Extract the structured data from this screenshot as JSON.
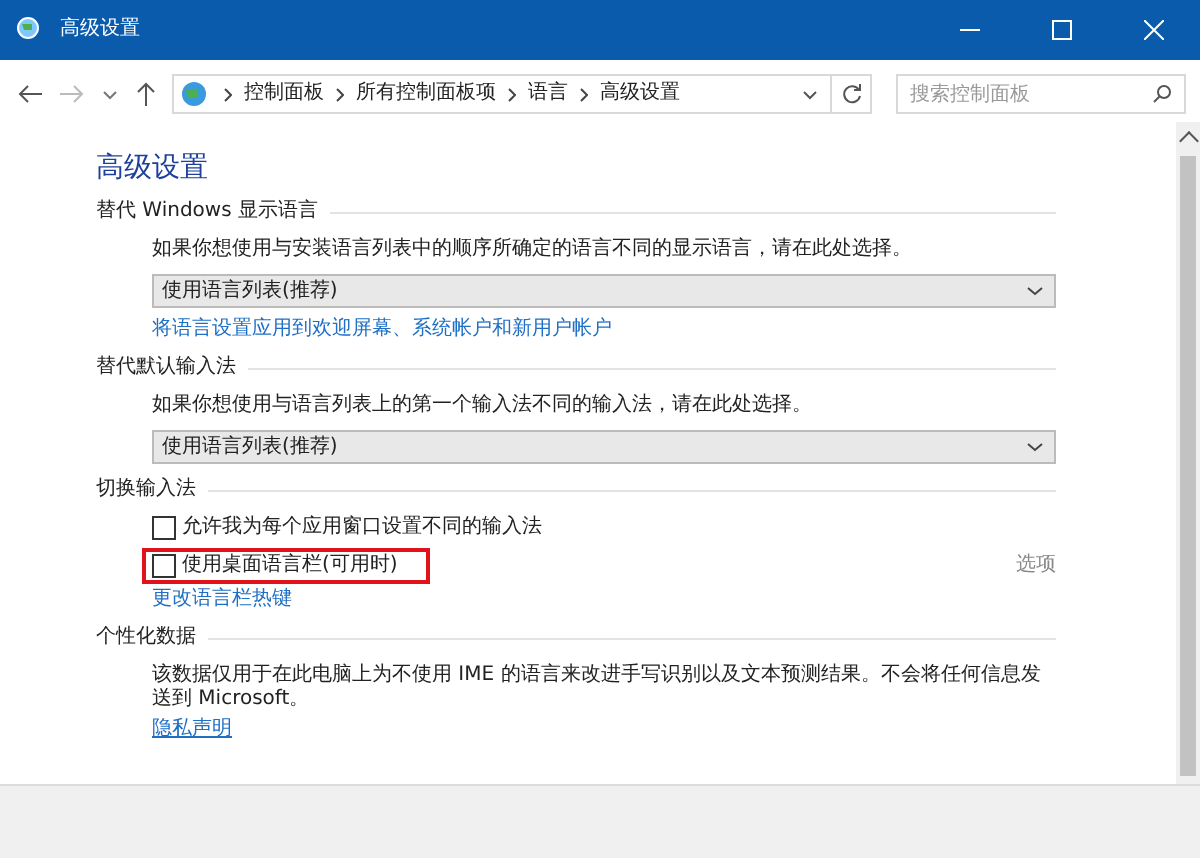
{
  "window": {
    "title": "高级设置"
  },
  "address_bar": {
    "crumbs": [
      "控制面板",
      "所有控制面板项",
      "语言",
      "高级设置"
    ]
  },
  "search": {
    "placeholder": "搜索控制面板"
  },
  "heading": "高级设置",
  "sections": [
    {
      "title": "替代 Windows 显示语言",
      "items": [
        {
          "kind": "text",
          "text": "如果你想使用与安装语言列表中的顺序所确定的语言不同的显示语言，请在此处选择。"
        },
        {
          "kind": "select",
          "value": "使用语言列表(推荐)"
        },
        {
          "kind": "link",
          "text": "将语言设置应用到欢迎屏幕、系统帐户和新用户帐户"
        }
      ]
    },
    {
      "title": "替代默认输入法",
      "items": [
        {
          "kind": "text",
          "text": "如果你想使用与语言列表上的第一个输入法不同的输入法，请在此处选择。"
        },
        {
          "kind": "select",
          "value": "使用语言列表(推荐)"
        }
      ]
    },
    {
      "title": "切换输入法",
      "items": [
        {
          "kind": "checkbox",
          "label": "允许我为每个应用窗口设置不同的输入法",
          "checked": false,
          "highlighted": false
        },
        {
          "kind": "checkbox",
          "label": "使用桌面语言栏(可用时)",
          "checked": false,
          "highlighted": true,
          "option": "选项"
        },
        {
          "kind": "link",
          "text": "更改语言栏热键"
        }
      ]
    },
    {
      "title": "个性化数据",
      "items": [
        {
          "kind": "text",
          "text": "该数据仅用于在此电脑上为不使用 IME 的语言来改进手写识别以及文本预测结果。不会将任何信息发送到 Microsoft。"
        },
        {
          "kind": "ulink",
          "text": "隐私声明"
        }
      ]
    }
  ]
}
